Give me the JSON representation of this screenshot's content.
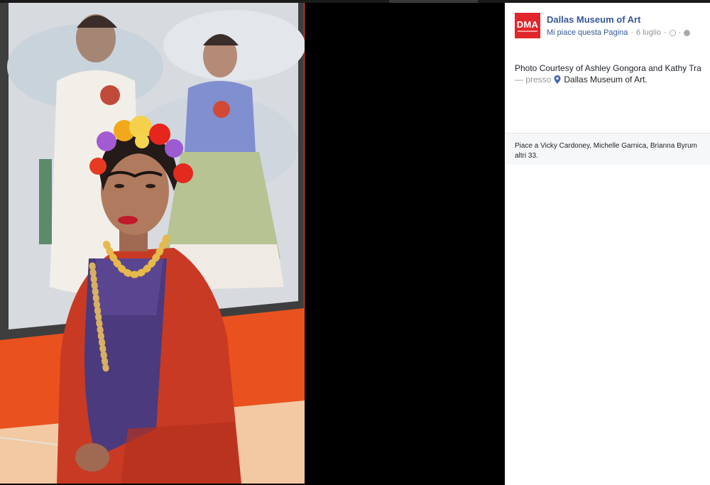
{
  "post": {
    "page_name": "Dallas Museum of Art",
    "logo_text": "DMA",
    "like_page_link": "Mi piace questa Pagina",
    "separator": "·",
    "date": "6 luglio",
    "meta_icons": [
      "clock-icon",
      "globe-icon"
    ],
    "caption": "Photo Courtesy of Ashley Gongora and Kathy Tra",
    "location_prefix": "— presso",
    "location": "Dallas Museum of Art.",
    "likes_line1": "Piace a Vicky Cardoney, Michelle Garnica, Brianna Byrum",
    "likes_line2": "altri 33."
  },
  "colors": {
    "brand_red": "#e0262a",
    "link_blue": "#365899",
    "meta_gray": "#90949c",
    "wall_orange": "#e9521e"
  }
}
